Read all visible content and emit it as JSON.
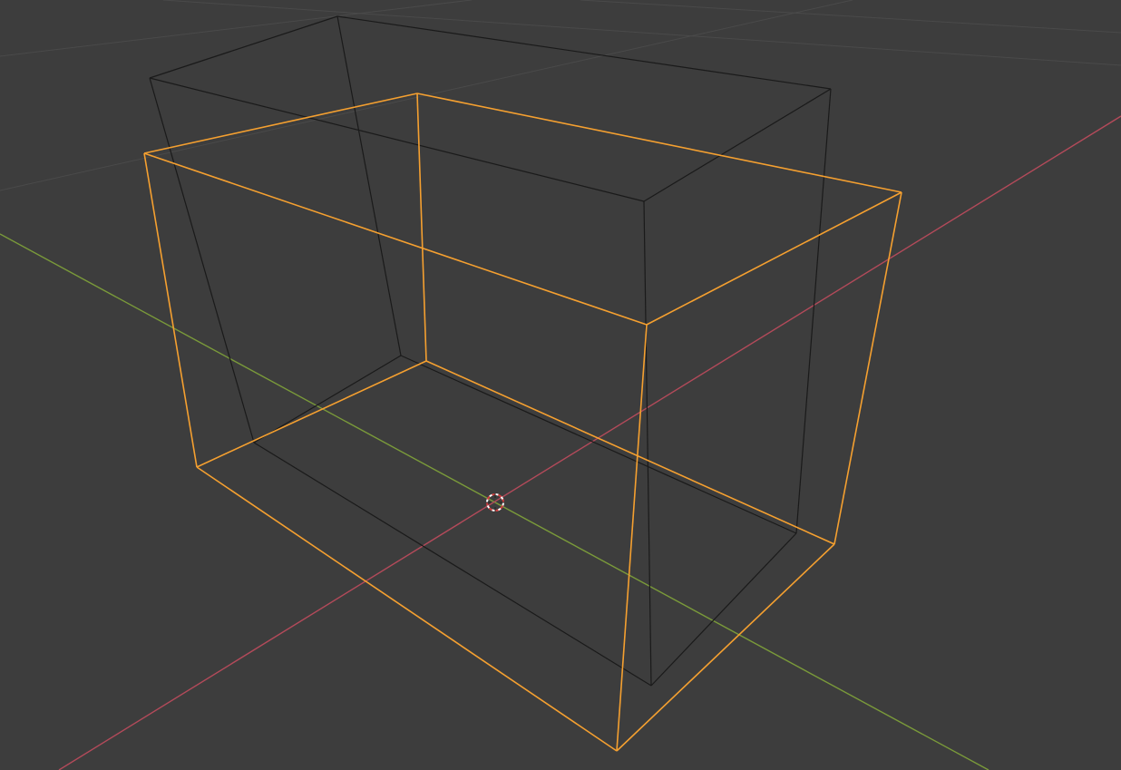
{
  "viewport": {
    "background_color": "#3d3d3d",
    "grid_color": "#4a4a4a",
    "x_axis_color": "#b34a5a",
    "y_axis_color": "#7a9a3a",
    "origin_marker_icon": "3d-cursor-icon"
  },
  "objects": {
    "unselected_box": {
      "edge_color": "#1a1a1a",
      "selected": false
    },
    "selected_box": {
      "edge_color": "#f5a030",
      "selected": true
    }
  }
}
